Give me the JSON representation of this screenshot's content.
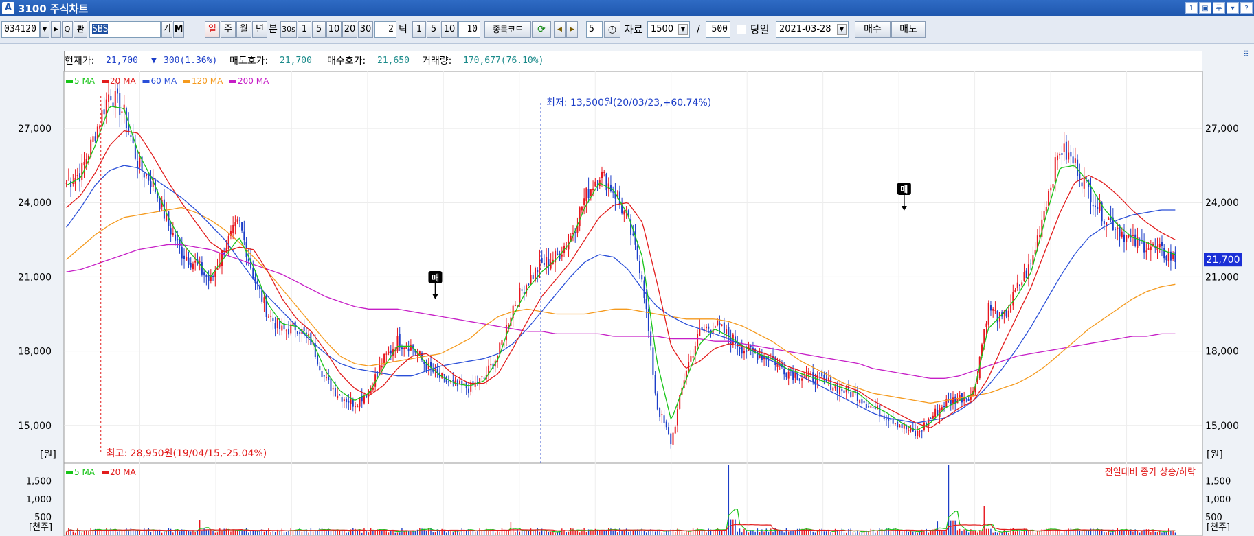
{
  "window": {
    "title": "3100 주식차트",
    "logo": "A",
    "buttons": [
      "1",
      "▣",
      "푸",
      "▾",
      "?"
    ]
  },
  "toolbar": {
    "code": "034120",
    "code_dropdown": "▼",
    "arrow_btn": "▸",
    "search_btn": "Q",
    "kwan_btn": "관",
    "name_value": "SBS",
    "gi_btn": "기",
    "m_btn": "M",
    "period_buttons": [
      "일",
      "주",
      "월",
      "년"
    ],
    "bun_label": "분",
    "minute_buttons": [
      "30s",
      "1",
      "5",
      "10",
      "20",
      "30"
    ],
    "minute_input": "2",
    "tick_label": "틱",
    "tick_buttons": [
      "1",
      "5",
      "10"
    ],
    "tick_input": "10",
    "jongmok_btn": "종목코드",
    "refresh_icon": "refresh-icon",
    "nav_prev": "◀",
    "nav_next": "▶",
    "step_value": "5",
    "clock_icon": "clock-icon",
    "data_label": "자료",
    "data_value": "1500",
    "slash": "/",
    "display_value": "500",
    "today_label": "당일",
    "date_value": "2021-03-28",
    "buy_btn": "매수",
    "sell_btn": "매도"
  },
  "info": {
    "current_label": "현재가:",
    "current_value": "21,700",
    "change_arrow": "▼",
    "change_value": "300(1.36%)",
    "ask_label": "매도호가:",
    "ask_value": "21,700",
    "bid_label": "매수호가:",
    "bid_value": "21,650",
    "volume_label": "거래량:",
    "volume_value": "170,677(76.10%)"
  },
  "colors": {
    "up": "#e8161e",
    "down": "#1c3ec8",
    "ma5": "#18c418",
    "ma20": "#e21c1c",
    "ma60": "#2a4fd8",
    "ma120": "#f59a1e",
    "ma200": "#c61ec6"
  },
  "chart_data": [
    {
      "type": "candlestick",
      "legend": [
        {
          "name": "5 MA",
          "color": "#18c418"
        },
        {
          "name": "20 MA",
          "color": "#e21c1c"
        },
        {
          "name": "60 MA",
          "color": "#2a4fd8"
        },
        {
          "name": "120 MA",
          "color": "#f59a1e"
        },
        {
          "name": "200 MA",
          "color": "#c61ec6"
        }
      ],
      "y_ticks": [
        "27,000",
        "24,000",
        "21,000",
        "18,000",
        "15,000"
      ],
      "y_tick_values": [
        27000,
        24000,
        21000,
        18000,
        15000
      ],
      "ylim": [
        13500,
        29300
      ],
      "unit": "[원]",
      "last_price_label": "21,700",
      "last_price": 21700,
      "annotations": {
        "low": "최저: 13,500원(20/03/23,+60.74%)",
        "high": "최고: 28,950원(19/04/15,-25.04%)",
        "signal": "매"
      },
      "close_trace": [
        24800,
        25200,
        26800,
        28500,
        27600,
        25500,
        24800,
        23200,
        22000,
        21500,
        20800,
        22200,
        23200,
        21000,
        19500,
        18800,
        19000,
        18400,
        16800,
        16200,
        15900,
        16400,
        17600,
        18400,
        18200,
        17400,
        16900,
        16600,
        16500,
        16900,
        17900,
        19800,
        20800,
        21500,
        21800,
        22600,
        24200,
        25200,
        24500,
        23200,
        21000,
        15800,
        14300,
        17200,
        18800,
        19100,
        18600,
        18100,
        17900,
        17700,
        17200,
        17000,
        16900,
        16700,
        16400,
        16200,
        15700,
        15400,
        15000,
        14600,
        15300,
        15900,
        16100,
        16300,
        19800,
        19200,
        20500,
        21500,
        24000,
        26200,
        25600,
        24500,
        23500,
        23000,
        22400,
        22300,
        22000,
        21700
      ],
      "ma_traces": {
        "ma5": [
          24700,
          25000,
          26300,
          27900,
          27800,
          26000,
          24900,
          23500,
          22400,
          21700,
          21000,
          21800,
          22600,
          21400,
          19900,
          19100,
          19000,
          18500,
          17200,
          16400,
          16000,
          16300,
          17300,
          18200,
          18200,
          17500,
          17000,
          16700,
          16600,
          16800,
          17700,
          19400,
          20500,
          21200,
          21700,
          22400,
          23800,
          24800,
          24500,
          23500,
          21800,
          17600,
          15200,
          16800,
          18300,
          18900,
          18600,
          18200,
          17900,
          17700,
          17300,
          17100,
          16900,
          16700,
          16500,
          16300,
          15800,
          15500,
          15100,
          14800,
          15100,
          15700,
          16000,
          16300,
          18900,
          19500,
          20200,
          21200,
          23400,
          25400,
          25500,
          24800,
          23800,
          23100,
          22600,
          22400,
          22100,
          21900
        ],
        "ma20": [
          23800,
          24300,
          25200,
          26300,
          26900,
          26800,
          25900,
          24900,
          24000,
          23200,
          22400,
          22000,
          22200,
          22100,
          21200,
          20100,
          19300,
          18800,
          18000,
          17100,
          16500,
          16200,
          16600,
          17300,
          17800,
          17900,
          17500,
          17000,
          16700,
          16700,
          17100,
          18100,
          19200,
          20200,
          20900,
          21600,
          22500,
          23400,
          23900,
          24000,
          23200,
          20800,
          18200,
          17300,
          17600,
          18100,
          18300,
          18200,
          18000,
          17800,
          17400,
          17200,
          17000,
          16800,
          16600,
          16400,
          16000,
          15700,
          15400,
          15100,
          14900,
          15300,
          15700,
          16000,
          16900,
          18200,
          19400,
          20600,
          22100,
          23600,
          24800,
          25100,
          24800,
          24300,
          23700,
          23200,
          22800,
          22500
        ],
        "ma60": [
          23000,
          23800,
          24700,
          25300,
          25500,
          25400,
          25000,
          24600,
          24200,
          23700,
          23100,
          22500,
          21700,
          20900,
          20200,
          19600,
          19000,
          18400,
          17900,
          17500,
          17300,
          17200,
          17100,
          17000,
          17000,
          17200,
          17400,
          17500,
          17600,
          17700,
          17900,
          18300,
          18900,
          19600,
          20300,
          21000,
          21600,
          21900,
          21800,
          21300,
          20500,
          19800,
          19400,
          19100,
          18900,
          18700,
          18500,
          18200,
          17900,
          17600,
          17300,
          17000,
          16700,
          16400,
          16100,
          15800,
          15500,
          15300,
          15200,
          15100,
          15200,
          15300,
          15600,
          16000,
          16600,
          17300,
          18100,
          19000,
          20000,
          21000,
          21900,
          22600,
          23000,
          23300,
          23500,
          23600,
          23700,
          23700
        ],
        "ma120": [
          21700,
          22200,
          22700,
          23100,
          23400,
          23500,
          23600,
          23700,
          23800,
          23600,
          23300,
          22900,
          22400,
          21800,
          21200,
          20500,
          19800,
          19100,
          18400,
          17800,
          17500,
          17400,
          17500,
          17600,
          17700,
          17800,
          17900,
          18200,
          18500,
          19000,
          19400,
          19600,
          19700,
          19600,
          19500,
          19500,
          19500,
          19600,
          19700,
          19700,
          19600,
          19500,
          19400,
          19300,
          19300,
          19300,
          19200,
          19000,
          18700,
          18400,
          18000,
          17600,
          17300,
          17000,
          16700,
          16500,
          16300,
          16200,
          16100,
          16000,
          15900,
          16000,
          16100,
          16200,
          16300,
          16500,
          16700,
          17000,
          17400,
          17900,
          18400,
          18900,
          19300,
          19700,
          20100,
          20400,
          20600,
          20700
        ],
        "ma200": [
          21200,
          21300,
          21500,
          21700,
          21900,
          22100,
          22200,
          22300,
          22300,
          22200,
          22100,
          21900,
          21700,
          21500,
          21300,
          21100,
          20800,
          20500,
          20200,
          20000,
          19800,
          19700,
          19700,
          19700,
          19600,
          19500,
          19400,
          19300,
          19200,
          19100,
          19000,
          18900,
          18800,
          18800,
          18700,
          18700,
          18700,
          18700,
          18600,
          18600,
          18600,
          18600,
          18500,
          18500,
          18500,
          18400,
          18400,
          18300,
          18200,
          18100,
          18000,
          17900,
          17800,
          17700,
          17600,
          17500,
          17300,
          17200,
          17100,
          17000,
          16900,
          16900,
          17000,
          17200,
          17400,
          17600,
          17800,
          17900,
          18000,
          18100,
          18200,
          18300,
          18400,
          18500,
          18600,
          18600,
          18700,
          18700
        ]
      }
    },
    {
      "type": "bar",
      "legend": [
        {
          "name": "5 MA",
          "color": "#18c418"
        },
        {
          "name": "20 MA",
          "color": "#e21c1c"
        }
      ],
      "title_right": "전일대비 종가 상승/하락",
      "y_ticks": [
        "1,500",
        "1,000",
        "500"
      ],
      "y_tick_values": [
        1500,
        1000,
        500
      ],
      "ylim": [
        0,
        1800
      ],
      "unit": "[천주]",
      "spikes": [
        {
          "pos": 0.598,
          "value": 2150
        },
        {
          "pos": 0.795,
          "value": 1950
        },
        {
          "pos": 0.827,
          "value": 800
        },
        {
          "pos": 0.785,
          "value": 380
        },
        {
          "pos": 0.12,
          "value": 420
        },
        {
          "pos": 0.4,
          "value": 350
        }
      ]
    }
  ]
}
